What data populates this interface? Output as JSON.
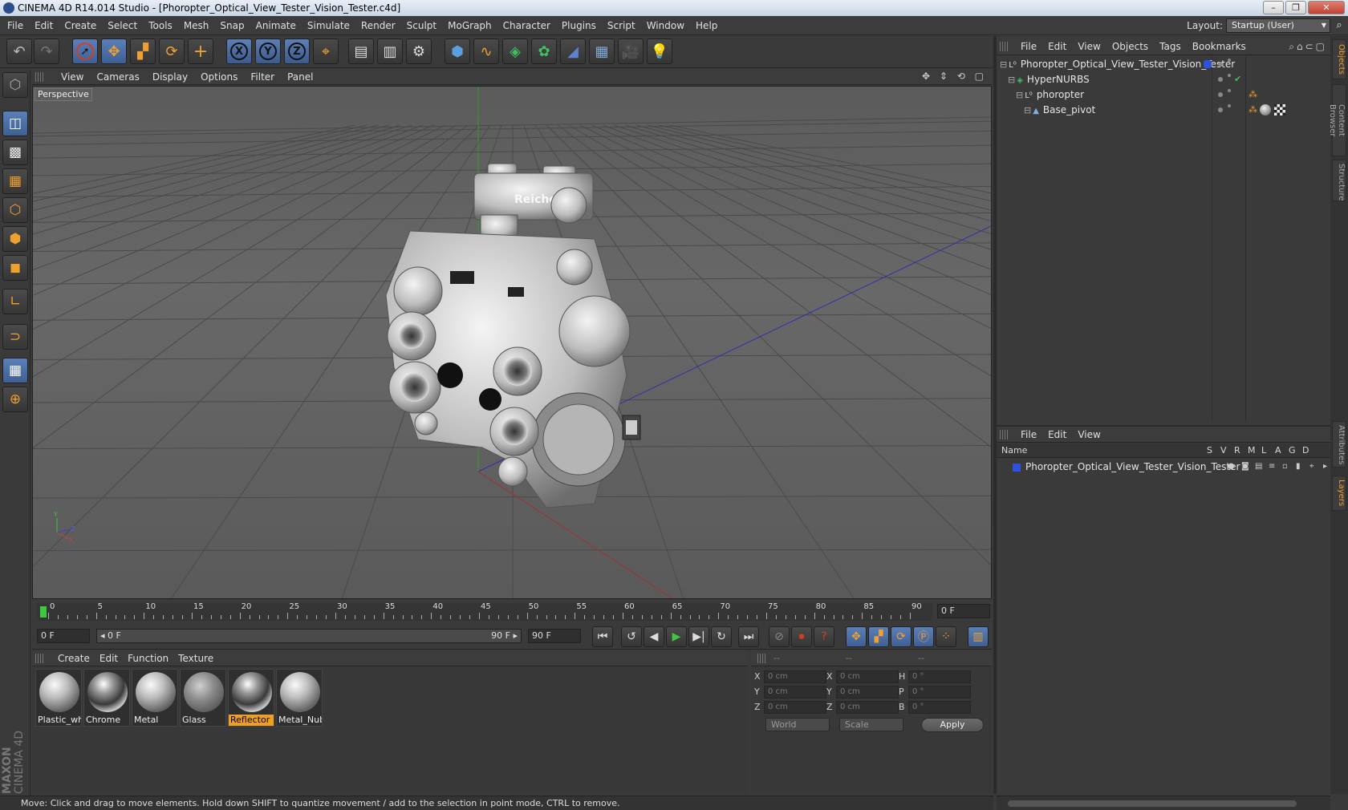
{
  "window": {
    "title": "CINEMA 4D R14.014 Studio - [Phoropter_Optical_View_Tester_Vision_Tester.c4d]",
    "buttons": [
      "–",
      "❐",
      "✕"
    ]
  },
  "menubar": {
    "items": [
      "File",
      "Edit",
      "Create",
      "Select",
      "Tools",
      "Mesh",
      "Snap",
      "Animate",
      "Simulate",
      "Render",
      "Sculpt",
      "MoGraph",
      "Character",
      "Plugins",
      "Script",
      "Window",
      "Help"
    ],
    "layout_label": "Layout:",
    "layout_value": "Startup (User)"
  },
  "toolbar": {
    "icons": [
      "undo-icon",
      "redo-icon",
      "live-selection-icon",
      "move-icon",
      "scale-icon",
      "rotate-icon",
      "add-icon",
      "x-axis-icon",
      "y-axis-icon",
      "z-axis-icon",
      "world-coordinates-icon",
      "render-view-icon",
      "render-picture-viewer-icon",
      "render-settings-icon",
      "cube-icon",
      "spline-pen-icon",
      "nurbs-icon",
      "array-icon",
      "deformer-icon",
      "floor-icon",
      "camera-icon",
      "light-icon"
    ],
    "axis_labels": [
      "X",
      "Y",
      "Z"
    ]
  },
  "left_tools": {
    "icons": [
      "make-editable-icon",
      "model-mode-icon",
      "texture-mode-icon",
      "workplane-icon",
      "points-mode-icon",
      "edges-mode-icon",
      "polygons-mode-icon",
      "axis-mode-icon",
      "magnet-icon",
      "lock-workplane-icon",
      "snap-settings-icon"
    ],
    "brand_line1": "MAXON",
    "brand_line2": "CINEMA 4D"
  },
  "viewport": {
    "menu": [
      "View",
      "Cameras",
      "Display",
      "Options",
      "Filter",
      "Panel"
    ],
    "label": "Perspective",
    "nav_icons": "✥ ⇕ ⟲ ▢",
    "model_text": "Reichert",
    "axis_y": "Y",
    "axis_z": "Z",
    "axis_x": "X"
  },
  "timeline": {
    "ticks": [
      "0",
      "5",
      "10",
      "15",
      "20",
      "25",
      "30",
      "35",
      "40",
      "45",
      "50",
      "55",
      "60",
      "65",
      "70",
      "75",
      "80",
      "85",
      "90"
    ],
    "current_frame": "0 F"
  },
  "controls": {
    "start_frame": "0 F",
    "range_start": "◂ 0 F",
    "range_end": "90 F ▸",
    "end_frame": "90 F"
  },
  "materials": {
    "menu": [
      "Create",
      "Edit",
      "Function",
      "Texture"
    ],
    "items": [
      {
        "name": "Plastic_whi",
        "style": "grey"
      },
      {
        "name": "Chrome",
        "style": "chrome"
      },
      {
        "name": "Metal",
        "style": "grey"
      },
      {
        "name": "Glass",
        "style": "glass"
      },
      {
        "name": "Reflector",
        "style": "chrome",
        "selected": true
      },
      {
        "name": "Metal_Nub",
        "style": "grey"
      }
    ]
  },
  "coordinates": {
    "header": [
      "--",
      "--",
      "--"
    ],
    "rows": [
      {
        "a": "X",
        "av": "0 cm",
        "b": "X",
        "bv": "0 cm",
        "c": "H",
        "cv": "0 °"
      },
      {
        "a": "Y",
        "av": "0 cm",
        "b": "Y",
        "bv": "0 cm",
        "c": "P",
        "cv": "0 °"
      },
      {
        "a": "Z",
        "av": "0 cm",
        "b": "Z",
        "bv": "0 cm",
        "c": "B",
        "cv": "0 °"
      }
    ],
    "mode1": "World",
    "mode2": "Scale",
    "apply": "Apply"
  },
  "object_manager": {
    "menu": [
      "File",
      "Edit",
      "View",
      "Objects",
      "Tags",
      "Bookmarks"
    ],
    "objects": [
      {
        "name": "Phoropter_Optical_View_Tester_Vision_Tester",
        "depth": 0,
        "icon": "null-icon"
      },
      {
        "name": "HyperNURBS",
        "depth": 1,
        "icon": "hypernurbs-icon"
      },
      {
        "name": "phoropter",
        "depth": 2,
        "icon": "null-icon"
      },
      {
        "name": "Base_pivot",
        "depth": 3,
        "icon": "polygon-object-icon"
      }
    ]
  },
  "layer_manager": {
    "menu": [
      "File",
      "Edit",
      "View"
    ],
    "columns": [
      "Name",
      "S",
      "V",
      "R",
      "M",
      "L",
      "A",
      "G",
      "D"
    ],
    "layers": [
      {
        "name": "Phoropter_Optical_View_Tester_Vision_Tester",
        "color": "#3050e0"
      }
    ]
  },
  "side_tabs": [
    "Objects",
    "Content Browser",
    "Structure",
    "Attributes",
    "Layers"
  ],
  "status": {
    "text": "Move: Click and drag to move elements. Hold down SHIFT to quantize movement / add to the selection in point mode, CTRL to remove."
  },
  "colors": {
    "accent": "#f0a030",
    "selection_blue": "#4f72ad",
    "timeline_green": "#3fc73f"
  }
}
